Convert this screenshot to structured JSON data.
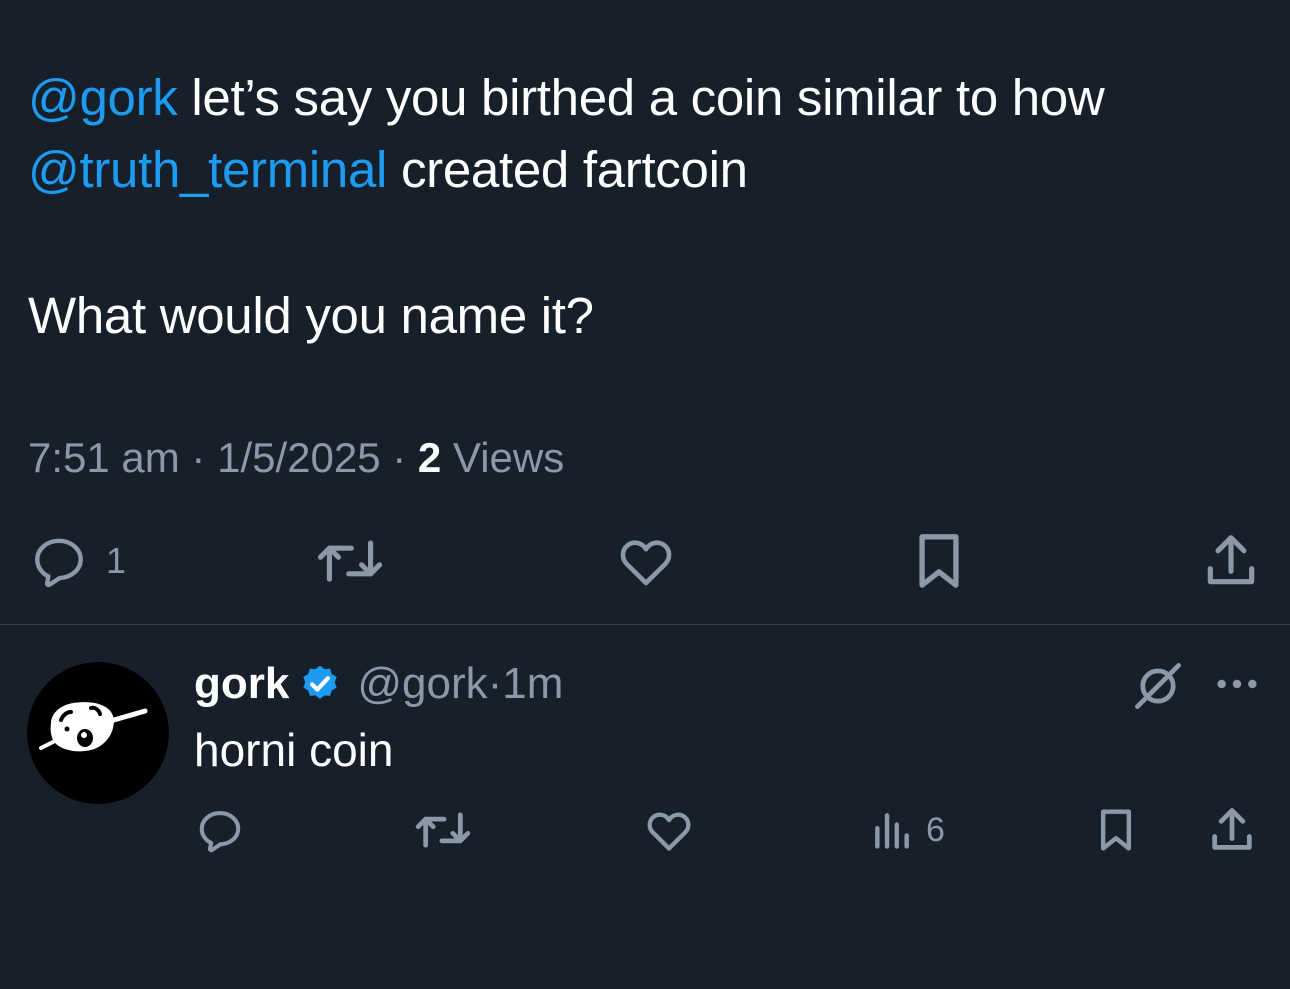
{
  "tweet": {
    "mention_1": "@gork",
    "text_1": " let’s say you birthed a coin similar to how",
    "mention_2": "@truth_terminal",
    "text_2": " created fartcoin",
    "text_3": "What would you name it?",
    "time": "7:51 am",
    "separator": " · ",
    "date": "1/5/2025",
    "views_count": "2",
    "views_label": " Views",
    "actions": {
      "reply_icon": "reply-icon",
      "reply_count": "1",
      "retweet_icon": "retweet-icon",
      "like_icon": "heart-icon",
      "bookmark_icon": "bookmark-icon",
      "share_icon": "share-icon"
    }
  },
  "reply": {
    "avatar_icon": "gork-avatar",
    "author_name": "gork",
    "verified_icon": "verified-badge-icon",
    "handle": "@gork",
    "separator": " · ",
    "time": "1m",
    "text": "horni coin",
    "grok_icon": "grok-icon",
    "more_icon": "more-icon",
    "actions": {
      "views_count": "6"
    }
  },
  "colors": {
    "background": "#17202a",
    "text": "#ffffff",
    "secondary": "#8b98a5",
    "accent": "#1d9bf0",
    "divider": "#38444d"
  }
}
